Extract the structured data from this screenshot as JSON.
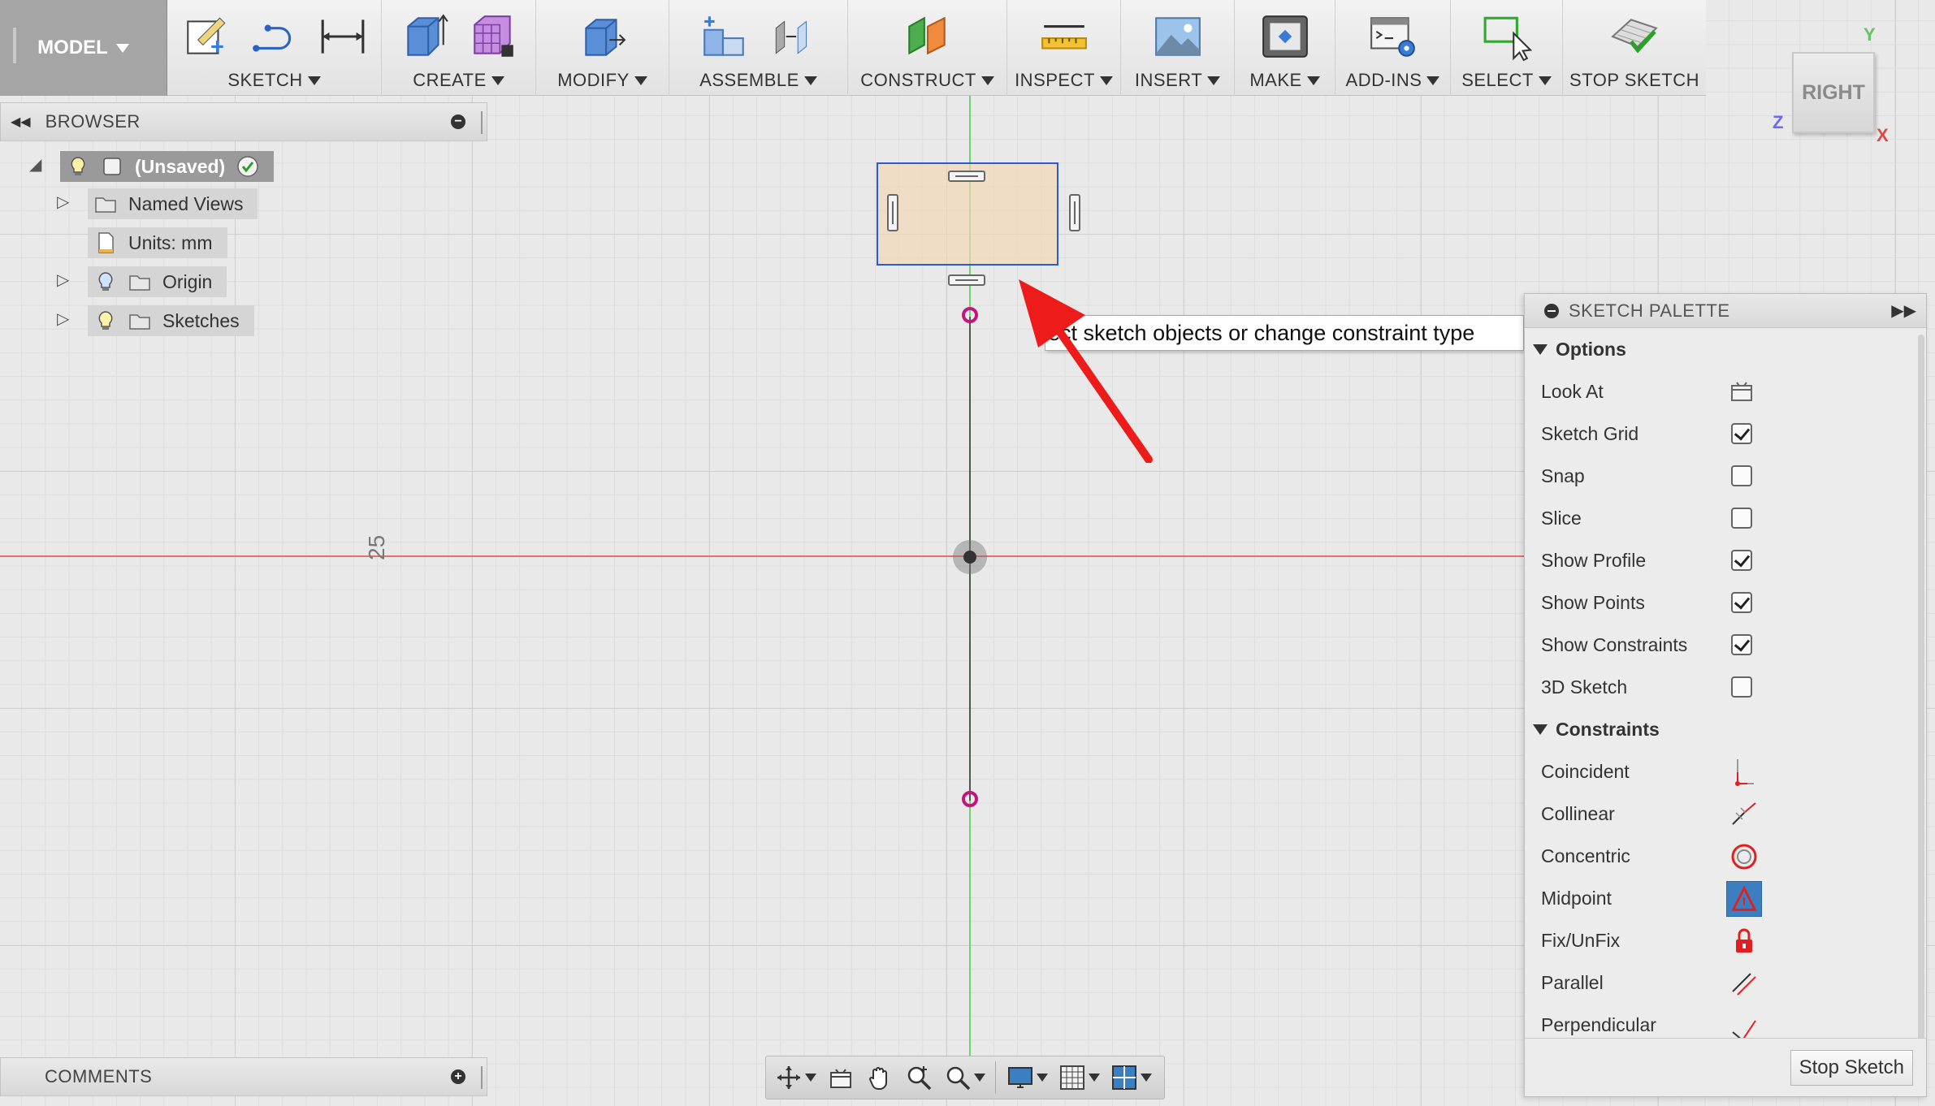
{
  "toolbar": {
    "model_label": "MODEL",
    "groups": [
      {
        "label": "SKETCH"
      },
      {
        "label": "CREATE"
      },
      {
        "label": "MODIFY"
      },
      {
        "label": "ASSEMBLE"
      },
      {
        "label": "CONSTRUCT"
      },
      {
        "label": "INSPECT"
      },
      {
        "label": "INSERT"
      },
      {
        "label": "MAKE"
      },
      {
        "label": "ADD-INS"
      },
      {
        "label": "SELECT"
      },
      {
        "label": "STOP SKETCH"
      }
    ]
  },
  "viewcube": {
    "face_label": "RIGHT",
    "axis_y": "Y",
    "axis_z": "Z",
    "axis_x": "X"
  },
  "browser": {
    "title": "BROWSER",
    "root_label": "(Unsaved)",
    "items": [
      {
        "label": "Named Views"
      },
      {
        "label": "Units: mm"
      },
      {
        "label": "Origin"
      },
      {
        "label": "Sketches"
      }
    ]
  },
  "canvas": {
    "dimension_label": "25",
    "tooltip": "Select sketch objects or change constraint type"
  },
  "palette": {
    "title": "SKETCH PALETTE",
    "options_title": "Options",
    "options": [
      {
        "label": "Look At"
      },
      {
        "label": "Sketch Grid",
        "checked": true
      },
      {
        "label": "Snap",
        "checked": false
      },
      {
        "label": "Slice",
        "checked": false
      },
      {
        "label": "Show Profile",
        "checked": true
      },
      {
        "label": "Show Points",
        "checked": true
      },
      {
        "label": "Show Constraints",
        "checked": true
      },
      {
        "label": "3D Sketch",
        "checked": false
      }
    ],
    "constraints_title": "Constraints",
    "constraints": [
      {
        "label": "Coincident",
        "icon": "coincident-icon"
      },
      {
        "label": "Collinear",
        "icon": "collinear-icon"
      },
      {
        "label": "Concentric",
        "icon": "concentric-icon"
      },
      {
        "label": "Midpoint",
        "icon": "midpoint-icon",
        "active": true
      },
      {
        "label": "Fix/UnFix",
        "icon": "lock-icon"
      },
      {
        "label": "Parallel",
        "icon": "parallel-icon"
      },
      {
        "label": "Perpendicular",
        "icon": "perpendicular-icon"
      }
    ],
    "stop_button": "Stop Sketch"
  },
  "comments": {
    "title": "COMMENTS"
  },
  "colors": {
    "green_axis": "#6fd36f",
    "red_axis": "#e36f6f",
    "selection_blue": "#2a5bd7",
    "sketch_point": "#c4157c",
    "arrow_red": "#ee1b1b",
    "active_tool": "#3c7fc1"
  }
}
